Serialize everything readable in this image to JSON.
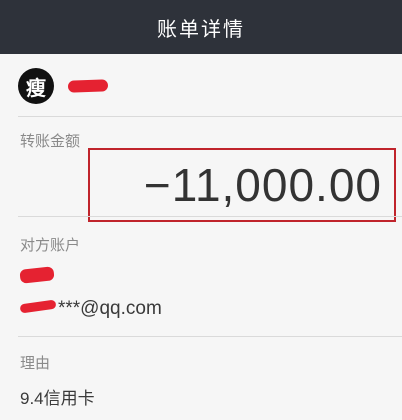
{
  "header": {
    "title": "账单详情"
  },
  "user": {
    "avatar_char": "瘦"
  },
  "transfer": {
    "amount_label": "转账金额",
    "amount": "−11,000.00"
  },
  "counterparty": {
    "label": "对方账户",
    "account_suffix": "***@qq.com"
  },
  "reason": {
    "label": "理由",
    "value": "9.4信用卡"
  },
  "colors": {
    "header_bg": "#2e323a",
    "highlight_box": "#c0242c",
    "redaction": "#e52231"
  }
}
